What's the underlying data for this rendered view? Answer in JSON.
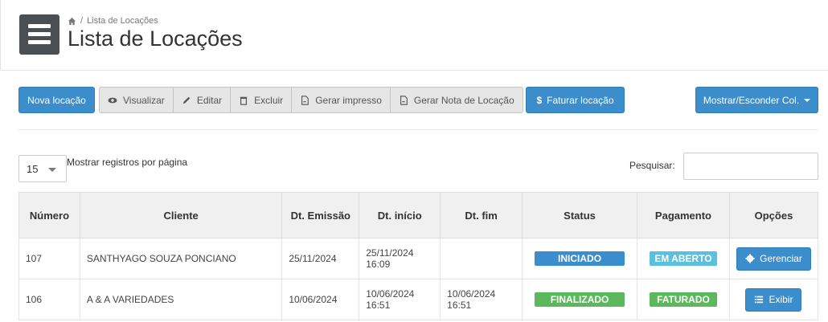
{
  "breadcrumb": {
    "current": "Lista de Locações"
  },
  "page": {
    "title": "Lista de Locações"
  },
  "toolbar": {
    "new_label": "Nova locação",
    "view_label": "Visualizar",
    "edit_label": "Editar",
    "delete_label": "Excluir",
    "print_label": "Gerar impresso",
    "note_label": "Gerar Nota de Locação",
    "bill_label": "Faturar locação",
    "bill_icon": "$",
    "columns_label": "Mostrar/Esconder Col."
  },
  "list_controls": {
    "page_size": "15",
    "page_size_label": "Mostrar registros por página",
    "search_label": "Pesquisar:",
    "search_value": ""
  },
  "table": {
    "headers": {
      "numero": "Número",
      "cliente": "Cliente",
      "emissao": "Dt. Emissão",
      "inicio": "Dt. início",
      "fim": "Dt. fim",
      "status": "Status",
      "pagamento": "Pagamento",
      "opcoes": "Opções"
    },
    "rows": [
      {
        "numero": "107",
        "cliente": "SANTHYAGO SOUZA PONCIANO",
        "emissao": "25/11/2024",
        "inicio_date": "25/11/2024",
        "inicio_time": "16:09",
        "fim_date": "",
        "fim_time": "",
        "status": "INICIADO",
        "pagamento": "EM ABERTO",
        "action": "Gerenciar"
      },
      {
        "numero": "106",
        "cliente": "A & A VARIEDADES",
        "emissao": "10/06/2024",
        "inicio_date": "10/06/2024",
        "inicio_time": "16:51",
        "fim_date": "10/06/2024",
        "fim_time": "16:51",
        "status": "FINALIZADO",
        "pagamento": "FATURADO",
        "action": "Exibir"
      }
    ]
  },
  "colors": {
    "primary": "#3c8dcc",
    "info": "#5bc0de",
    "success": "#5cb85c",
    "menu_bg": "#4a4f54"
  }
}
